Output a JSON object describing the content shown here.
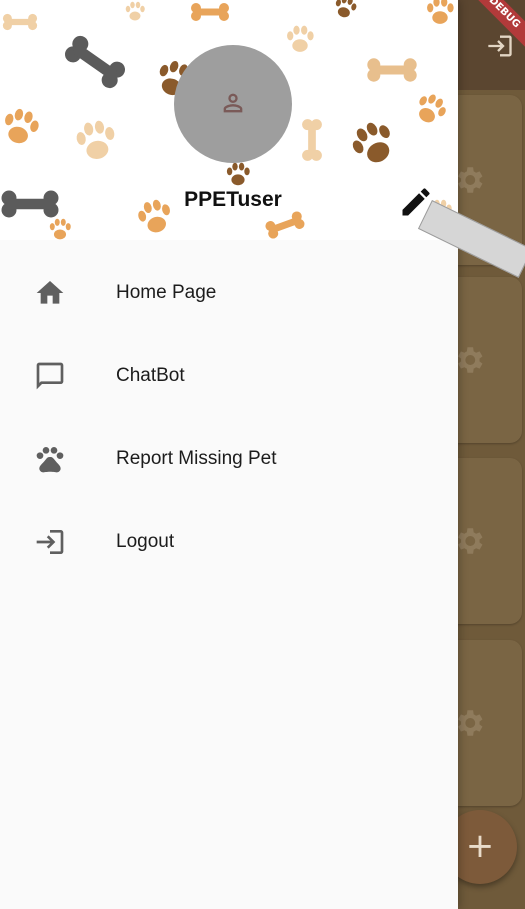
{
  "background": {
    "debug_ribbon": "DEBUG",
    "fab_label": "+",
    "appbar_icon": "login-icon",
    "card_icon": "gear-icon",
    "colors": {
      "app_background": "#6f5a3a",
      "card": "#7a6544",
      "fab": "#7d5a3a"
    }
  },
  "drawer": {
    "header": {
      "username": "PPETuser",
      "avatar_icon": "person-icon",
      "edit_icon": "pencil-icon",
      "pattern": "paw-and-bone-pattern"
    },
    "menu": [
      {
        "label": "Home Page",
        "icon": "home-icon"
      },
      {
        "label": "ChatBot",
        "icon": "chat-bubble-icon"
      },
      {
        "label": "Report Missing Pet",
        "icon": "paw-icon"
      },
      {
        "label": "Logout",
        "icon": "logout-icon"
      }
    ],
    "colors": {
      "drawer_background": "#fafafa",
      "avatar": "#9e9e9e",
      "icon": "#5f5f5f",
      "text": "#1c1c1c"
    }
  }
}
